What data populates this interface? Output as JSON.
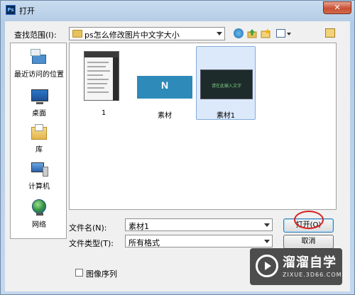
{
  "window": {
    "title": "打开",
    "app_icon": "Ps",
    "close_label": "✕"
  },
  "look_in": {
    "label": "查找范围(I):",
    "value": "ps怎么修改图片中文字大小"
  },
  "toolbar": {
    "icons": [
      "back-icon",
      "up-folder-icon",
      "new-folder-icon",
      "view-menu-icon",
      "pin-icon"
    ]
  },
  "places": [
    {
      "label": "最近访问的位置",
      "icon": "recent-places-icon"
    },
    {
      "label": "桌面",
      "icon": "desktop-icon"
    },
    {
      "label": "库",
      "icon": "libraries-icon"
    },
    {
      "label": "计算机",
      "icon": "computer-icon"
    },
    {
      "label": "网络",
      "icon": "network-icon"
    }
  ],
  "files": [
    {
      "name": "1",
      "selected": false
    },
    {
      "name": "素材",
      "selected": false,
      "thumb_text": "N"
    },
    {
      "name": "素材1",
      "selected": true,
      "thumb_text": "请在此输入文字"
    }
  ],
  "filename": {
    "label": "文件名(N):",
    "value": "素材1"
  },
  "filetype": {
    "label": "文件类型(T):",
    "value": "所有格式"
  },
  "buttons": {
    "open": "打开(O)",
    "cancel": "取消"
  },
  "image_sequence": {
    "label": "图像序列",
    "checked": false
  },
  "watermark": {
    "title": "溜溜自学",
    "url": "ZIXUE.3D66.COM"
  }
}
